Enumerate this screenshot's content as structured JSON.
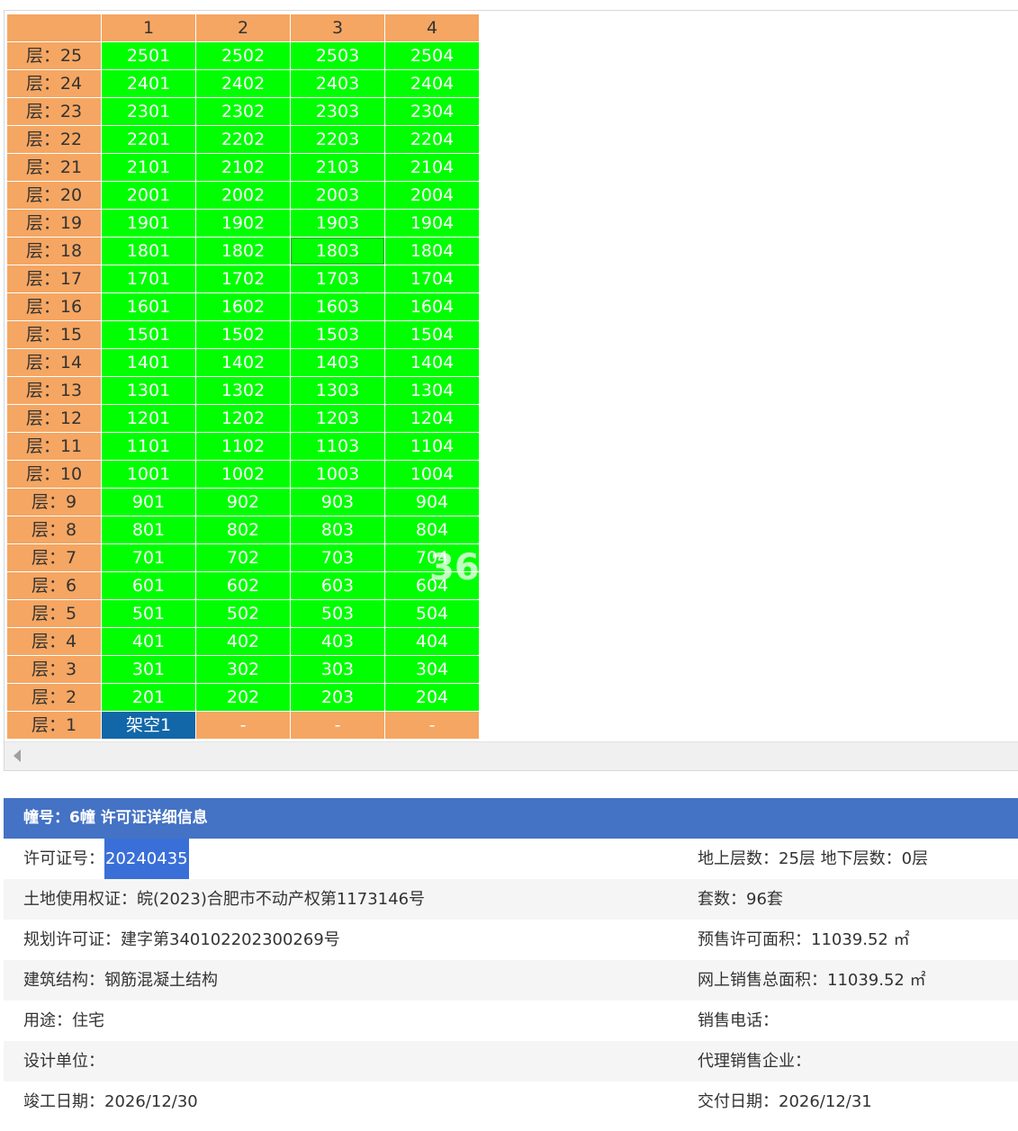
{
  "grid": {
    "columns": [
      "1",
      "2",
      "3",
      "4"
    ],
    "rows": [
      {
        "floor": "层：25",
        "units": [
          "2501",
          "2502",
          "2503",
          "2504"
        ]
      },
      {
        "floor": "层：24",
        "units": [
          "2401",
          "2402",
          "2403",
          "2404"
        ]
      },
      {
        "floor": "层：23",
        "units": [
          "2301",
          "2302",
          "2303",
          "2304"
        ]
      },
      {
        "floor": "层：22",
        "units": [
          "2201",
          "2202",
          "2203",
          "2204"
        ]
      },
      {
        "floor": "层：21",
        "units": [
          "2101",
          "2102",
          "2103",
          "2104"
        ]
      },
      {
        "floor": "层：20",
        "units": [
          "2001",
          "2002",
          "2003",
          "2004"
        ]
      },
      {
        "floor": "层：19",
        "units": [
          "1901",
          "1902",
          "1903",
          "1904"
        ]
      },
      {
        "floor": "层：18",
        "units": [
          "1801",
          "1802",
          "1803",
          "1804"
        ]
      },
      {
        "floor": "层：17",
        "units": [
          "1701",
          "1702",
          "1703",
          "1704"
        ]
      },
      {
        "floor": "层：16",
        "units": [
          "1601",
          "1602",
          "1603",
          "1604"
        ]
      },
      {
        "floor": "层：15",
        "units": [
          "1501",
          "1502",
          "1503",
          "1504"
        ]
      },
      {
        "floor": "层：14",
        "units": [
          "1401",
          "1402",
          "1403",
          "1404"
        ]
      },
      {
        "floor": "层：13",
        "units": [
          "1301",
          "1302",
          "1303",
          "1304"
        ]
      },
      {
        "floor": "层：12",
        "units": [
          "1201",
          "1202",
          "1203",
          "1204"
        ]
      },
      {
        "floor": "层：11",
        "units": [
          "1101",
          "1102",
          "1103",
          "1104"
        ]
      },
      {
        "floor": "层：10",
        "units": [
          "1001",
          "1002",
          "1003",
          "1004"
        ]
      },
      {
        "floor": "层：9",
        "units": [
          "901",
          "902",
          "903",
          "904"
        ]
      },
      {
        "floor": "层：8",
        "units": [
          "801",
          "802",
          "803",
          "804"
        ]
      },
      {
        "floor": "层：7",
        "units": [
          "701",
          "702",
          "703",
          "704"
        ]
      },
      {
        "floor": "层：6",
        "units": [
          "601",
          "602",
          "603",
          "604"
        ]
      },
      {
        "floor": "层：5",
        "units": [
          "501",
          "502",
          "503",
          "504"
        ]
      },
      {
        "floor": "层：4",
        "units": [
          "401",
          "402",
          "403",
          "404"
        ]
      },
      {
        "floor": "层：3",
        "units": [
          "301",
          "302",
          "303",
          "304"
        ]
      },
      {
        "floor": "层：2",
        "units": [
          "201",
          "202",
          "203",
          "204"
        ]
      },
      {
        "floor": "层：1",
        "units": [
          "架空1",
          "-",
          "-",
          "-"
        ]
      }
    ],
    "selected_unit": "1803",
    "colors": {
      "header": "#f5a662",
      "available": "#00ff00",
      "special": "#1167a8",
      "empty": "#f5a662"
    }
  },
  "watermark": {
    "text": "36"
  },
  "details": {
    "header": "幢号：6幢 许可证详细信息",
    "permit_no_label": "许可证号：",
    "permit_no_value": "20240435",
    "floors": "地上层数：25层  地下层数：0层",
    "land_cert": "土地使用权证：皖(2023)合肥市不动产权第1173146号",
    "suites": "套数：96套",
    "planning_permit": "规划许可证：建字第340102202300269号",
    "presale_area": "预售许可面积：11039.52 ㎡",
    "structure": "建筑结构：钢筋混凝土结构",
    "online_sales_area": "网上销售总面积：11039.52 ㎡",
    "usage": "用途：住宅",
    "sales_phone": "销售电话：",
    "design_unit": "设计单位：",
    "agent": "代理销售企业：",
    "completion_date": "竣工日期：2026/12/30",
    "delivery_date": "交付日期：2026/12/31"
  }
}
